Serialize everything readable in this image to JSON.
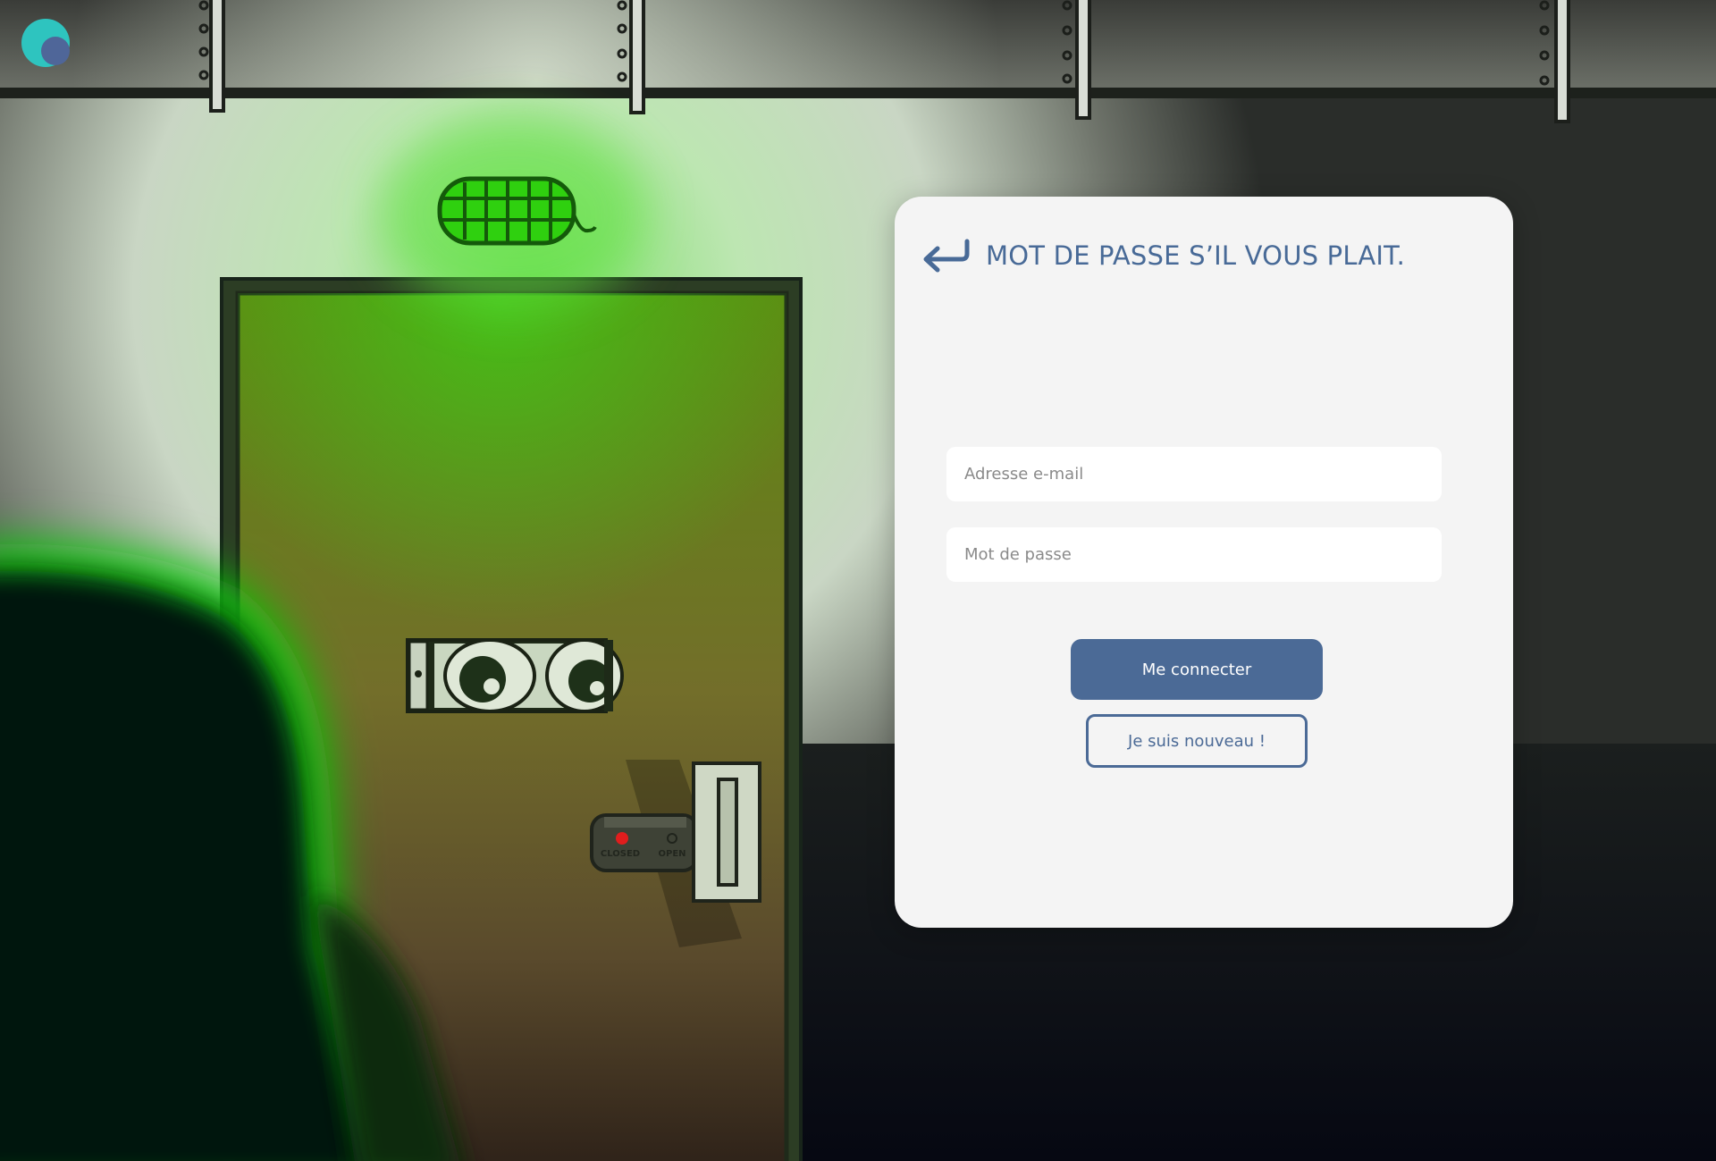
{
  "login": {
    "title": "MOT DE PASSE S’IL VOUS PLAIT.",
    "email_placeholder": "Adresse e-mail",
    "password_placeholder": "Mot de passe",
    "submit_label": "Me connecter",
    "signup_label": "Je suis nouveau !"
  },
  "scene": {
    "lock_closed_label": "CLOSED",
    "lock_open_label": "OPEN"
  },
  "colors": {
    "accent": "#4b6a96",
    "card_background": "#f4f4f4",
    "logo_teal": "#2ec4bf",
    "logo_navy": "#4f6699",
    "lamp_green": "#2fd00f"
  },
  "icons": {
    "back": "return-arrow-icon",
    "logo": "logo-icon"
  }
}
